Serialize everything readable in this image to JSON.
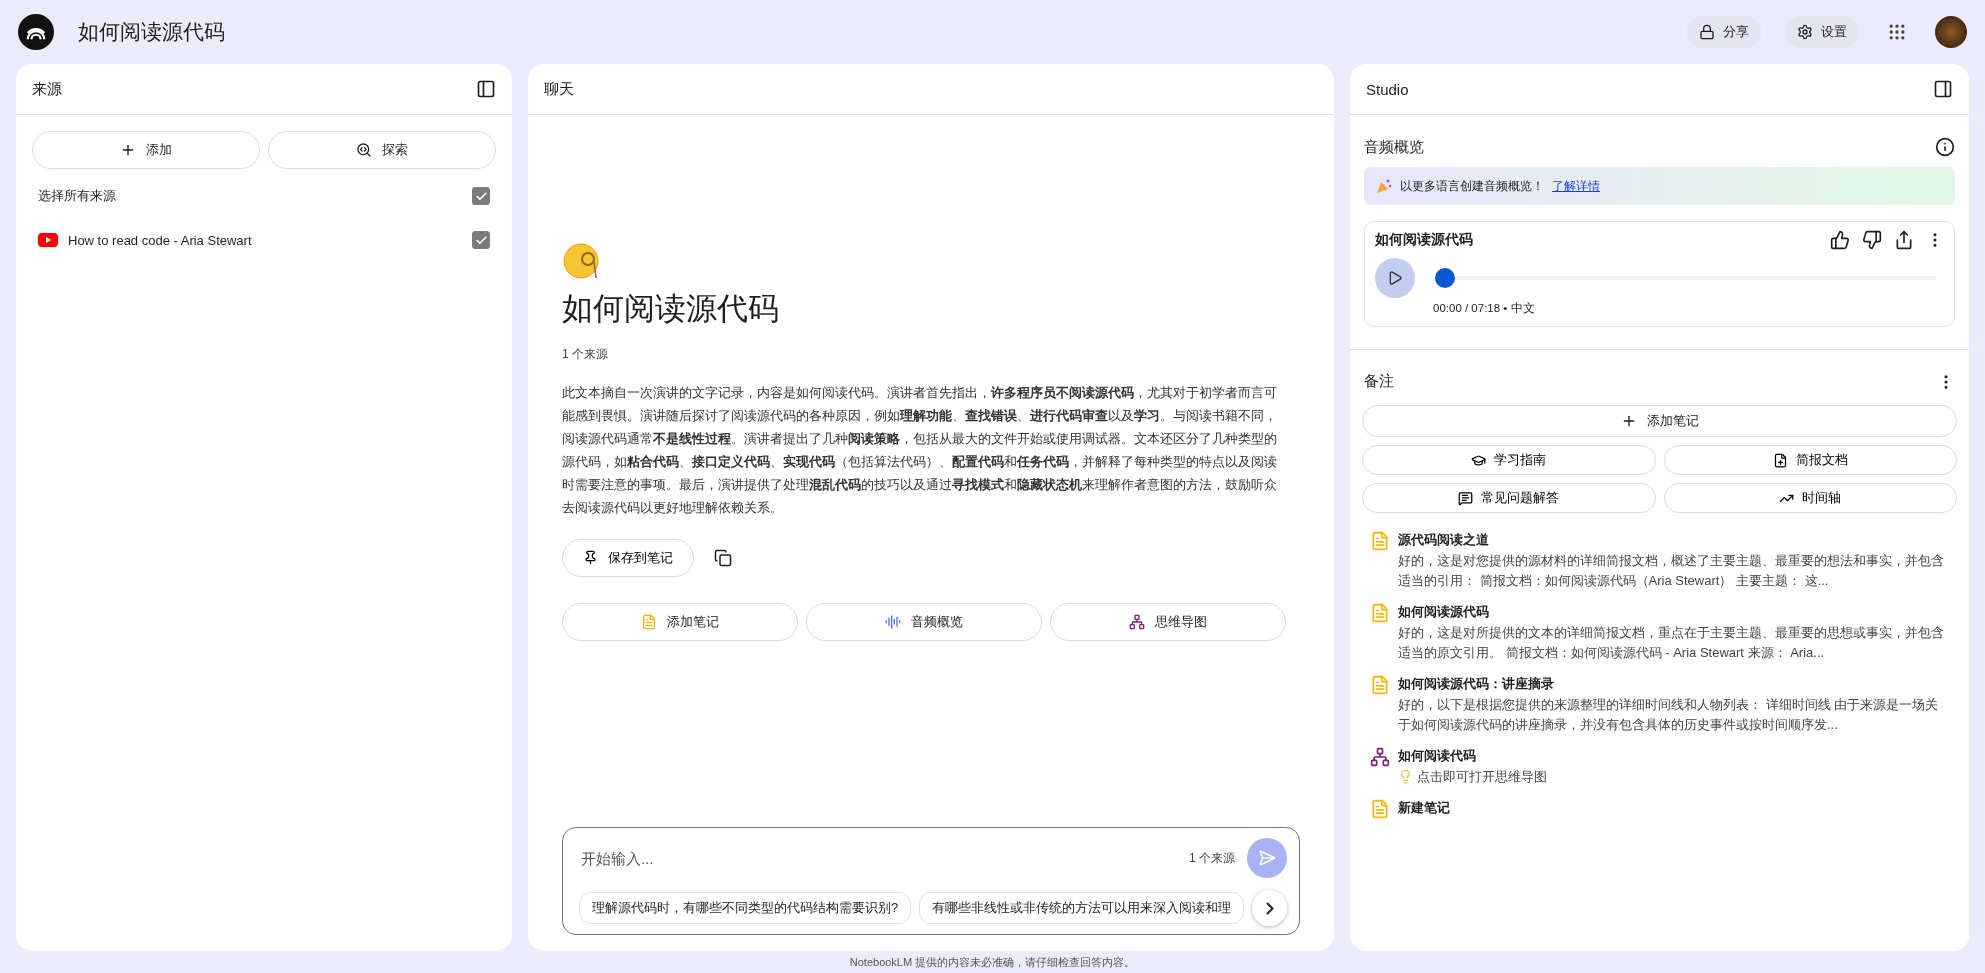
{
  "app": {
    "title": "如何阅读源代码",
    "share_label": "分享",
    "settings_label": "设置"
  },
  "sources": {
    "header": "来源",
    "add_label": "添加",
    "explore_label": "探索",
    "select_all": {
      "label": "选择所有来源",
      "checked": true
    },
    "items": [
      {
        "title": "How to read code - Aria Stewart",
        "checked": true
      }
    ]
  },
  "chat": {
    "header": "聊天",
    "title": "如何阅读源代码",
    "source_count": "1 个来源",
    "summary": "此文本摘自一次演讲的文字记录，内容是如何阅读代码。演讲者首先指出，**许多程序员不阅读源代码**，尤其对于初学者而言可能感到畏惧。演讲随后探讨了阅读源代码的各种原因，例如**理解功能**、**查找错误**、**进行代码审查**以及**学习**。与阅读书籍不同，阅读源代码通常**不是线性过程**。演讲者提出了几种**阅读策略**，包括从最大的文件开始或使用调试器。文本还区分了几种类型的源代码，如**粘合代码**、**接口定义代码**、**实现代码**（包括算法代码）、**配置代码**和**任务代码**，并解释了每种类型的特点以及阅读时需要注意的事项。最后，演讲提供了处理**混乱代码**的技巧以及通过**寻找模式**和**隐藏状态机**来理解作者意图的方法，鼓励听众去阅读源代码以更好地理解依赖关系。",
    "save_label": "保存到笔记",
    "actions": [
      {
        "kind": "note",
        "label": "添加笔记"
      },
      {
        "kind": "audio",
        "label": "音频概览"
      },
      {
        "kind": "mindmap",
        "label": "思维导图"
      }
    ],
    "input": {
      "placeholder": "开始输入...",
      "source_count": "1 个来源"
    },
    "suggestions": [
      "理解源代码时，有哪些不同类型的代码结构需要识别?",
      "有哪些非线性或非传统的方法可以用来深入阅读和理"
    ]
  },
  "studio": {
    "header": "Studio",
    "audio_header": "音频概览",
    "banner": {
      "text": "以更多语言创建音频概览！",
      "link": "了解详情"
    },
    "audio": {
      "title": "如何阅读源代码",
      "time": "00:00 / 07:18 • 中文",
      "level": 0
    },
    "notes_header": "备注",
    "add_note_label": "添加笔记",
    "tools": [
      {
        "kind": "guide",
        "label": "学习指南"
      },
      {
        "kind": "brief",
        "label": "简报文档"
      },
      {
        "kind": "faq",
        "label": "常见问题解答"
      },
      {
        "kind": "timeline",
        "label": "时间轴"
      }
    ],
    "notes": [
      {
        "kind": "note",
        "title": "源代码阅读之道",
        "body": "好的，这是对您提供的源材料的详细简报文档，概述了主要主题、最重要的想法和事实，并包含适当的引用： 简报文档：如何阅读源代码（Aria Stewart） 主要主题： 这..."
      },
      {
        "kind": "note",
        "title": "如何阅读源代码",
        "body": "好的，这是对所提供的文本的详细简报文档，重点在于主要主题、最重要的思想或事实，并包含适当的原文引用。 简报文档：如何阅读源代码 - Aria Stewart 来源： Aria..."
      },
      {
        "kind": "note",
        "title": "如何阅读源代码：讲座摘录",
        "body": "好的，以下是根据您提供的来源整理的详细时间线和人物列表： 详细时间线 由于来源是一场关于如何阅读源代码的讲座摘录，并没有包含具体的历史事件或按时间顺序发..."
      },
      {
        "kind": "mindmap",
        "title": "如何阅读代码",
        "body": "点击即可打开思维导图"
      },
      {
        "kind": "note",
        "title": "新建笔记"
      }
    ]
  },
  "footer": "NotebookLM 提供的内容未必准确，请仔细检查回答内容。"
}
